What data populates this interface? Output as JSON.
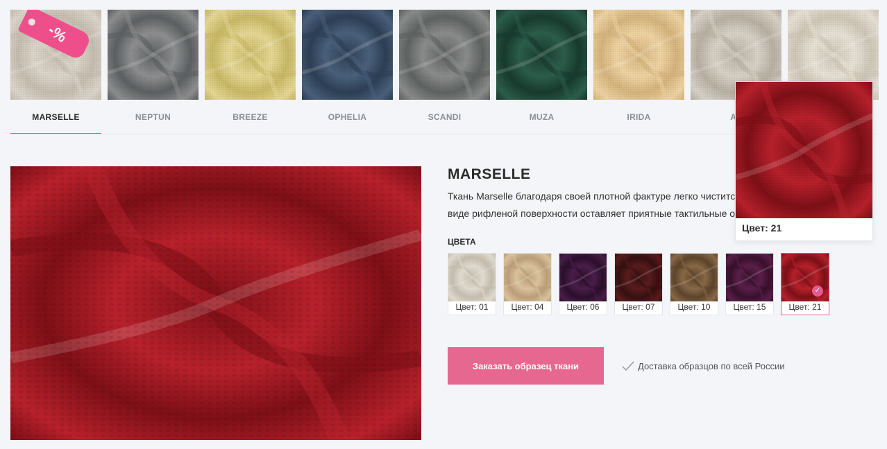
{
  "tabs": [
    {
      "label": "MARSELLE",
      "active": true,
      "color": "#dcd5ca",
      "shade": "#c6bdb0"
    },
    {
      "label": "NEPTUN",
      "active": false,
      "color": "#8d8f90",
      "shade": "#5d6062"
    },
    {
      "label": "BREEZE",
      "active": false,
      "color": "#e6d894",
      "shade": "#c9b966"
    },
    {
      "label": "OPHELIA",
      "active": false,
      "color": "#4a617c",
      "shade": "#2d3f55"
    },
    {
      "label": "SCANDI",
      "active": false,
      "color": "#8a8d8b",
      "shade": "#5f6361"
    },
    {
      "label": "MUZA",
      "active": false,
      "color": "#2c5e4c",
      "shade": "#183b2e"
    },
    {
      "label": "IRIDA",
      "active": false,
      "color": "#efd4a3",
      "shade": "#d6b47c"
    },
    {
      "label": "AF",
      "active": false,
      "color": "#d8d2c7",
      "shade": "#b9b0a3"
    },
    {
      "label": "",
      "active": false,
      "color": "#e7e1d6",
      "shade": "#cfc6b7"
    }
  ],
  "sale_badge": "-%",
  "product": {
    "title": "MARSELLE",
    "description_line1": "Ткань Marselle благодаря своей плотной фактуре легко чистится от пы",
    "description_line2": "виде рифленой поверхности оставляет приятные тактильные ощущен",
    "colors_label": "ЦВЕТА",
    "main_color": "#b8212b",
    "main_shade": "#7e0f17"
  },
  "swatches": [
    {
      "label": "Цвет: 01",
      "color": "#e3ddd2",
      "shade": "#c7bfb0",
      "selected": false
    },
    {
      "label": "Цвет: 04",
      "color": "#dcc59f",
      "shade": "#bda07a",
      "selected": false
    },
    {
      "label": "Цвет: 06",
      "color": "#4a1e4a",
      "shade": "#2c0f2c",
      "selected": false
    },
    {
      "label": "Цвет: 07",
      "color": "#5a1c1e",
      "shade": "#361011",
      "selected": false
    },
    {
      "label": "Цвет: 10",
      "color": "#8a6a47",
      "shade": "#5d452c",
      "selected": false
    },
    {
      "label": "Цвет: 15",
      "color": "#5b1f4a",
      "shade": "#38102c",
      "selected": false
    },
    {
      "label": "Цвет: 21",
      "color": "#b8212b",
      "shade": "#7e0f17",
      "selected": true
    }
  ],
  "order_button": "Заказать образец ткани",
  "delivery_text": "Доставка образцов по всей России",
  "popup": {
    "label": "Цвет: 21"
  }
}
